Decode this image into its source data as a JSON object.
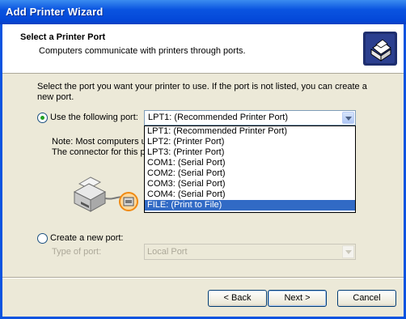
{
  "window": {
    "title": "Add Printer Wizard"
  },
  "header": {
    "title": "Select a Printer Port",
    "subtitle": "Computers communicate with printers through ports."
  },
  "instructions": "Select the port you want your printer to use.  If the port is not listed, you can create a new port.",
  "use_port": {
    "label": "Use the following port:",
    "selected": true,
    "combo_value": "LPT1: (Recommended Printer Port)",
    "options": [
      "LPT1: (Recommended Printer Port)",
      "LPT2: (Printer Port)",
      "LPT3: (Printer Port)",
      "COM1: (Serial Port)",
      "COM2: (Serial Port)",
      "COM3: (Serial Port)",
      "COM4: (Serial Port)",
      "FILE: (Print to File)"
    ],
    "highlighted_option": "FILE: (Print to File)"
  },
  "note": {
    "line1": "Note: Most computers u",
    "line2": "The connector for this p"
  },
  "create_port": {
    "label": "Create a new port:",
    "selected": false,
    "type_label": "Type of port:",
    "type_value": "Local Port"
  },
  "buttons": {
    "back": "< Back",
    "next": "Next >",
    "cancel": "Cancel"
  },
  "colors": {
    "title_bar": "#0a54e0",
    "selection": "#316ac5",
    "dialog_bg": "#ece9d8"
  }
}
